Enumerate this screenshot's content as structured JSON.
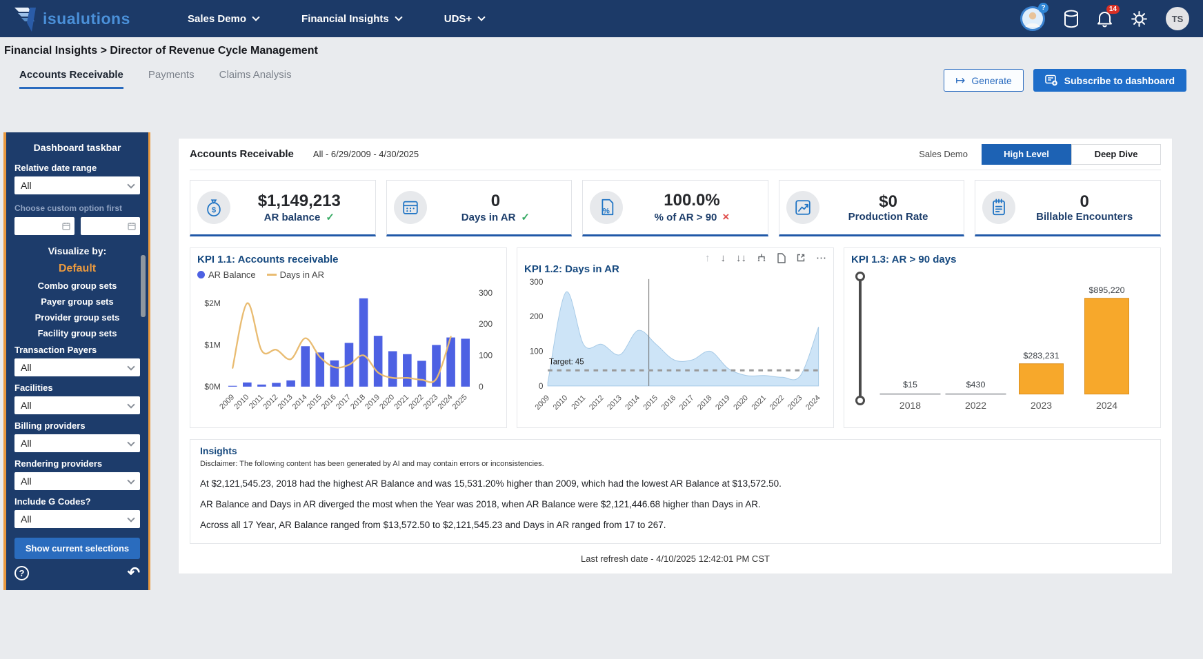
{
  "navbar": {
    "logo_text": "isualutions",
    "menus": [
      {
        "label": "Sales Demo"
      },
      {
        "label": "Financial Insights"
      },
      {
        "label": "UDS+"
      }
    ],
    "notification_count": "14",
    "avatar_initials": "TS"
  },
  "breadcrumb": "Financial Insights > Director of Revenue Cycle Management",
  "tabs": [
    {
      "label": "Accounts Receivable",
      "active": true
    },
    {
      "label": "Payments",
      "active": false
    },
    {
      "label": "Claims Analysis",
      "active": false
    }
  ],
  "actions": {
    "generate": "Generate",
    "subscribe": "Subscribe to dashboard"
  },
  "sidebar": {
    "title": "Dashboard taskbar",
    "relative_date_label": "Relative date range",
    "relative_date_value": "All",
    "custom_hint": "Choose custom option first",
    "visualize_label": "Visualize by:",
    "visualize_options": [
      {
        "label": "Default",
        "active": true
      },
      {
        "label": "Combo group sets"
      },
      {
        "label": "Payer group sets"
      },
      {
        "label": "Provider group sets"
      },
      {
        "label": "Facility group sets"
      }
    ],
    "filters": [
      {
        "label": "Transaction Payers",
        "value": "All"
      },
      {
        "label": "Facilities",
        "value": "All"
      },
      {
        "label": "Billing providers",
        "value": "All"
      },
      {
        "label": "Rendering providers",
        "value": "All"
      },
      {
        "label": "Include G Codes?",
        "value": "All"
      }
    ],
    "show_button": "Show current selections"
  },
  "main": {
    "header": {
      "title": "Accounts Receivable",
      "range": "All - 6/29/2009 - 4/30/2025",
      "context": "Sales Demo",
      "toggle": [
        {
          "label": "High Level",
          "active": true
        },
        {
          "label": "Deep Dive",
          "active": false
        }
      ]
    },
    "kpis": [
      {
        "value": "$1,149,213",
        "label": "AR balance",
        "status": "check",
        "status_glyph": "✓",
        "icon": "money-bag-icon"
      },
      {
        "value": "0",
        "label": "Days in AR",
        "status": "check",
        "status_glyph": "✓",
        "icon": "calendar-icon"
      },
      {
        "value": "100.0%",
        "label": "% of AR > 90",
        "status": "cross",
        "status_glyph": "×",
        "icon": "percent-document-icon"
      },
      {
        "value": "$0",
        "label": "Production Rate",
        "status": "none",
        "status_glyph": "",
        "icon": "trend-chart-icon"
      },
      {
        "value": "0",
        "label": "Billable Encounters",
        "status": "none",
        "status_glyph": "",
        "icon": "notepad-icon"
      }
    ],
    "insights": {
      "title": "Insights",
      "disclaimer": "Disclaimer: The following content has been generated by AI and may contain errors or inconsistencies.",
      "paragraphs": [
        "At $2,121,545.23, 2018 had the highest AR Balance and was 15,531.20% higher than 2009, which had the lowest AR Balance at $13,572.50.",
        "AR Balance and Days in AR diverged the most when the Year was 2018, when AR Balance were $2,121,446.68 higher than Days in AR.",
        "Across all 17 Year, AR Balance ranged from $13,572.50 to $2,121,545.23 and Days in AR ranged from 17 to 267."
      ]
    },
    "last_refresh": "Last refresh date - 4/10/2025 12:42:01 PM CST"
  },
  "chart_data": [
    {
      "id": "kpi-1-1",
      "type": "combo-bar-line",
      "title": "KPI 1.1: Accounts receivable",
      "legend": [
        {
          "name": "AR Balance",
          "color": "#4d61e3",
          "marker": "dot"
        },
        {
          "name": "Days in AR",
          "color": "#e9bc72",
          "marker": "line"
        }
      ],
      "categories": [
        "2009",
        "2010",
        "2011",
        "2012",
        "2013",
        "2014",
        "2015",
        "2016",
        "2017",
        "2018",
        "2019",
        "2020",
        "2021",
        "2022",
        "2023",
        "2024",
        "2025"
      ],
      "series": [
        {
          "name": "AR Balance",
          "type": "bar",
          "axis": "left",
          "unit": "$M",
          "values": [
            0.014,
            0.1,
            0.05,
            0.09,
            0.15,
            0.97,
            0.82,
            0.63,
            1.05,
            2.12,
            1.22,
            0.85,
            0.78,
            0.62,
            1.0,
            1.18,
            1.15
          ]
        },
        {
          "name": "Days in AR",
          "type": "line",
          "axis": "right",
          "values": [
            60,
            267,
            115,
            118,
            88,
            155,
            95,
            62,
            70,
            100,
            45,
            28,
            28,
            22,
            25,
            160,
            null
          ]
        }
      ],
      "left_axis": {
        "ticks": [
          "$0M",
          "$1M",
          "$2M"
        ],
        "tick_values": [
          0,
          1,
          2
        ],
        "max": 2.4
      },
      "right_axis": {
        "ticks": [
          0,
          100,
          200,
          300
        ],
        "max": 320
      },
      "bar_color": "#4d61e3",
      "line_color": "#e9bc72"
    },
    {
      "id": "kpi-1-2",
      "type": "area",
      "title": "KPI 1.2: Days in AR",
      "categories": [
        "2009",
        "2010",
        "2011",
        "2012",
        "2013",
        "2014",
        "2015",
        "2016",
        "2017",
        "2018",
        "2019",
        "2020",
        "2021",
        "2022",
        "2023",
        "2024"
      ],
      "values": [
        10,
        270,
        118,
        120,
        90,
        160,
        120,
        75,
        75,
        100,
        50,
        30,
        30,
        25,
        30,
        170
      ],
      "yticks": [
        0,
        100,
        200,
        300
      ],
      "ymax": 300,
      "target": {
        "label": "Target: 45",
        "value": 45
      },
      "cursor_index": 5.6,
      "fill": "#cde4f7",
      "stroke": "#a5c9e6",
      "toolbar_icons": [
        "arrow-up",
        "arrow-down",
        "double-arrow-down",
        "drill-down",
        "page",
        "expand",
        "more"
      ]
    },
    {
      "id": "kpi-1-3",
      "type": "bar",
      "title": "KPI 1.3: AR > 90 days",
      "categories": [
        "2018",
        "2022",
        "2023",
        "2024"
      ],
      "values": [
        15,
        430,
        283231,
        895220
      ],
      "labels": [
        "$15",
        "$430",
        "$283,231",
        "$895,220"
      ],
      "ymax": 1000000,
      "bar_color": "#f7a82b",
      "bar_border": "#db8f1f",
      "has_range_slider": true
    }
  ],
  "colors": {
    "navy": "#1c3a68",
    "sidebar_navy": "#1d3c6b",
    "orange_accent": "#e9993f",
    "primary_blue": "#1e6dc9",
    "active_toggle_blue": "#1d62b4",
    "bar_blue": "#4d61e3",
    "line_tan": "#e9bc72",
    "area_fill": "#cde4f7",
    "orange_bar": "#f7a82b",
    "check_green": "#36aa63",
    "cross_red": "#e0504e",
    "badge_red": "#d93025"
  }
}
